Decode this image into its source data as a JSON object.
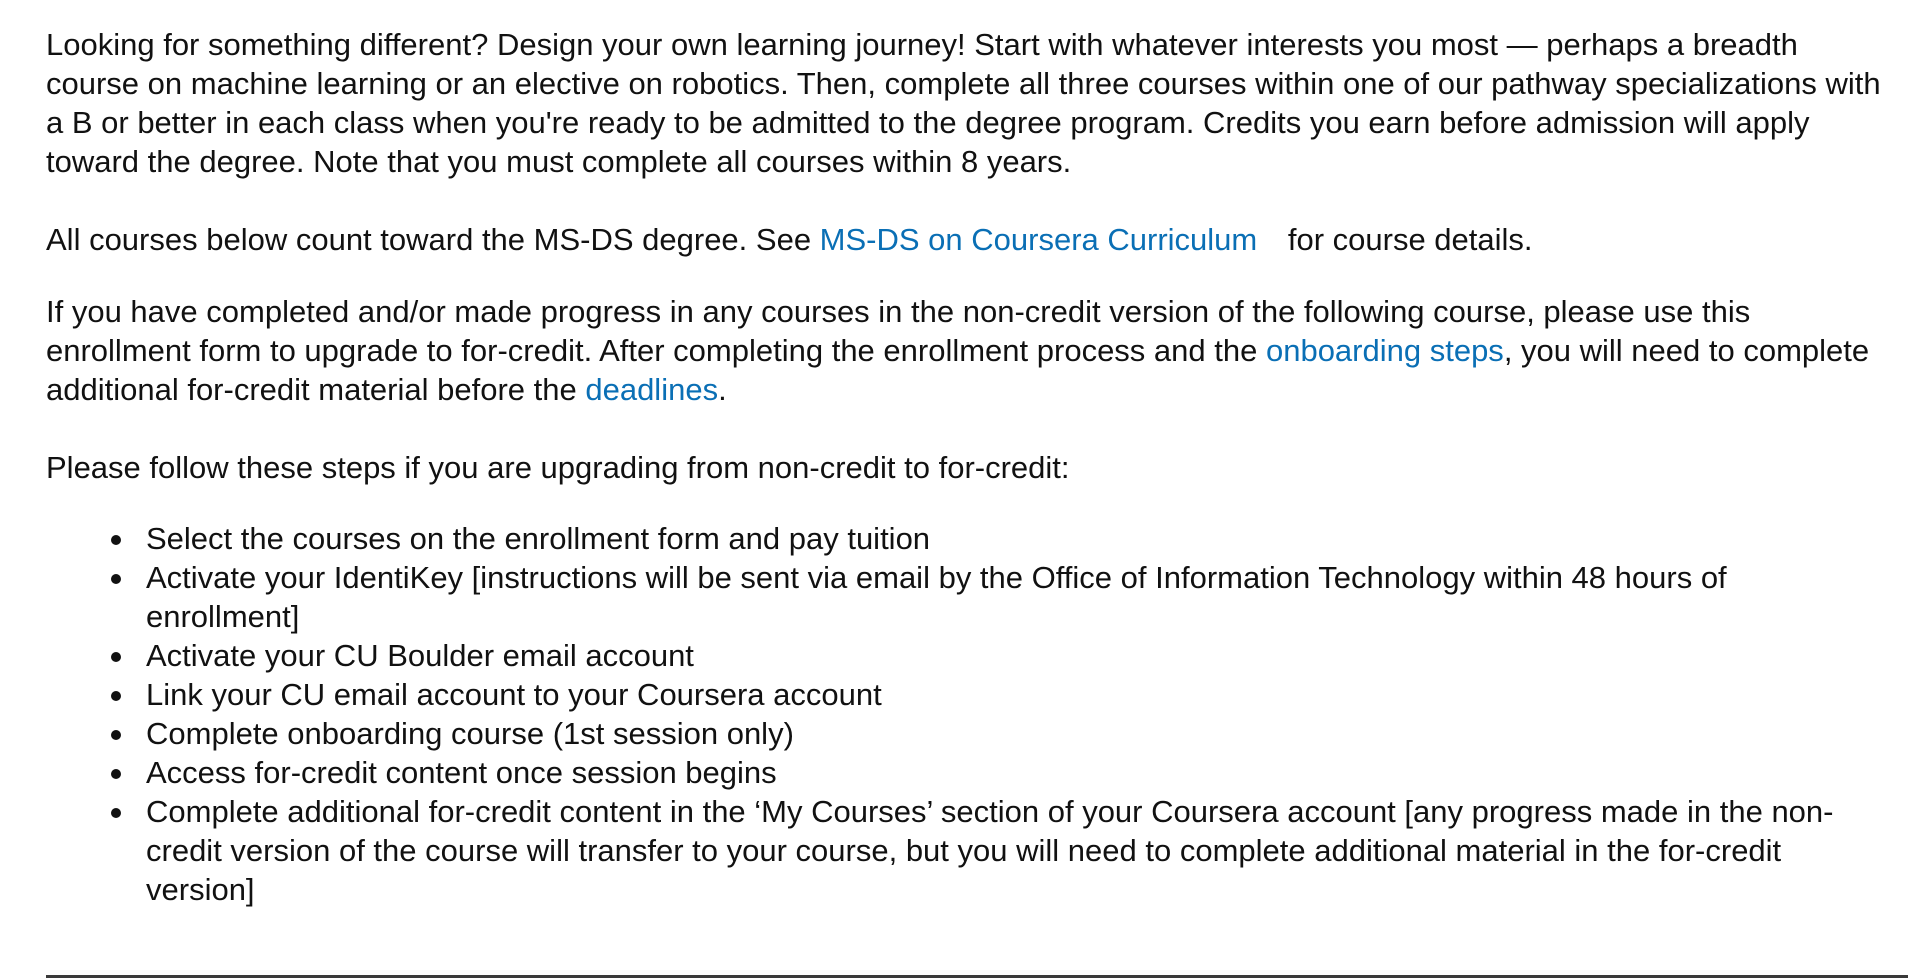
{
  "intro": {
    "text": "Looking for something different? Design your own learning journey! Start with whatever interests you most — perhaps a breadth course on machine learning or an elective on robotics. Then, complete all three courses within one of our pathway specializations with a B or better in each class when you're ready to be admitted to the degree program. Credits you earn before admission will apply toward the degree. Note that you must complete all courses within 8 years."
  },
  "degree_note": {
    "before": "All courses below count toward the MS-DS degree. See ",
    "link": "MS-DS on Coursera Curriculum",
    "after": "for course details."
  },
  "upgrade_note": {
    "text1": "If you have completed and/or made progress in any courses in the non-credit version of the following course, please use this enrollment form to upgrade to for-credit. After completing the enrollment process and the ",
    "link1": "onboarding steps",
    "text2": ", you will need to complete additional for-credit material before the ",
    "link2": "deadlines",
    "text3": "."
  },
  "steps_intro": "Please follow these steps if you are upgrading from non-credit to for-credit:",
  "steps": [
    "Select the courses on the enrollment form and pay tuition",
    "Activate your IdentiKey [instructions will be sent via email by the Office of Information Technology within 48 hours of enrollment]",
    "Activate your CU Boulder email account",
    "Link your CU email account to your Coursera account",
    "Complete onboarding course (1st session only)",
    "Access for-credit content once session begins",
    "Complete additional for-credit content in the ‘My Courses’ section of your Coursera account [any progress made in the non-credit version of the course will transfer to your course, but you will need to complete additional material in the for-credit version]"
  ],
  "colors": {
    "text": "#111111",
    "link": "#0a6fb5",
    "background": "#ffffff"
  }
}
